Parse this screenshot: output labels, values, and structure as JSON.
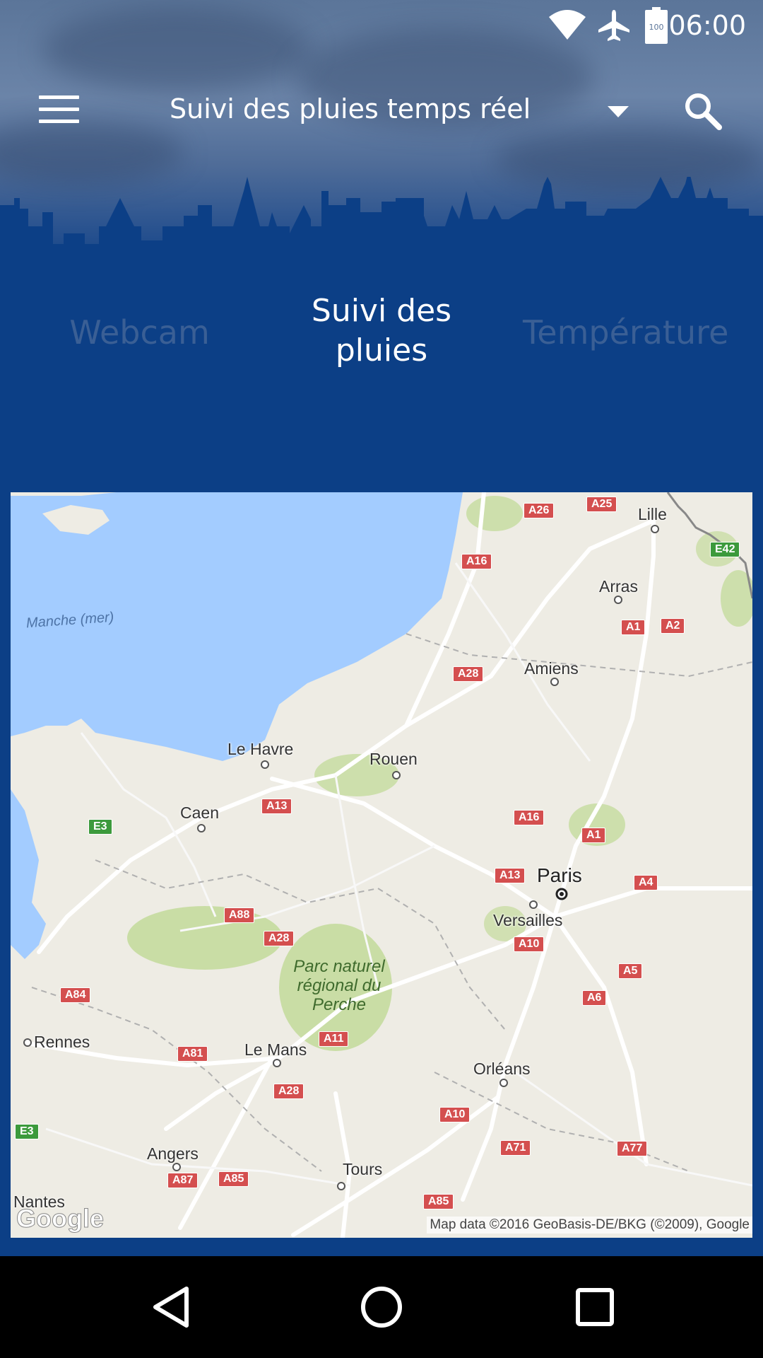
{
  "status_bar": {
    "time": "06:00",
    "battery_level": "100",
    "icons": [
      "wifi-icon",
      "airplane-mode-icon",
      "battery-icon"
    ]
  },
  "toolbar": {
    "title": "Suivi des pluies temps réel",
    "menu_icon": "hamburger-menu-icon",
    "dropdown_icon": "dropdown-arrow-icon",
    "search_icon": "search-icon"
  },
  "tabs": [
    {
      "label": "Webcam",
      "active": false
    },
    {
      "label": "Suivi des pluies",
      "active": true
    },
    {
      "label": "Température",
      "active": false
    }
  ],
  "map": {
    "sea_label": "Manche (mer)",
    "cities": [
      "Lille",
      "Arras",
      "Amiens",
      "Le Havre",
      "Rouen",
      "Caen",
      "Paris",
      "Versailles",
      "Rennes",
      "Le Mans",
      "Orléans",
      "Angers",
      "Tours",
      "Nantes"
    ],
    "park_label": "Parc naturel régional du Perche",
    "roads": [
      "A26",
      "A25",
      "E42",
      "A16",
      "A1",
      "A2",
      "A28",
      "A13",
      "A16",
      "A1",
      "E3",
      "A13",
      "A4",
      "A88",
      "A28",
      "A10",
      "A5",
      "A84",
      "A6",
      "A11",
      "A81",
      "A28",
      "A10",
      "E3",
      "A71",
      "A77",
      "A87",
      "A85",
      "A85"
    ],
    "google_logo": "Google",
    "attribution": "Map data ©2016 GeoBasis-DE/BKG (©2009), Google"
  },
  "nav_bar": {
    "back": "back-icon",
    "home": "home-icon",
    "recents": "recents-icon"
  },
  "colors": {
    "primary": "#0c3f86",
    "sea": "#a3ccff",
    "land": "#eeece4",
    "park": "#c4dc9d",
    "road_badge": "#d44f4f"
  }
}
